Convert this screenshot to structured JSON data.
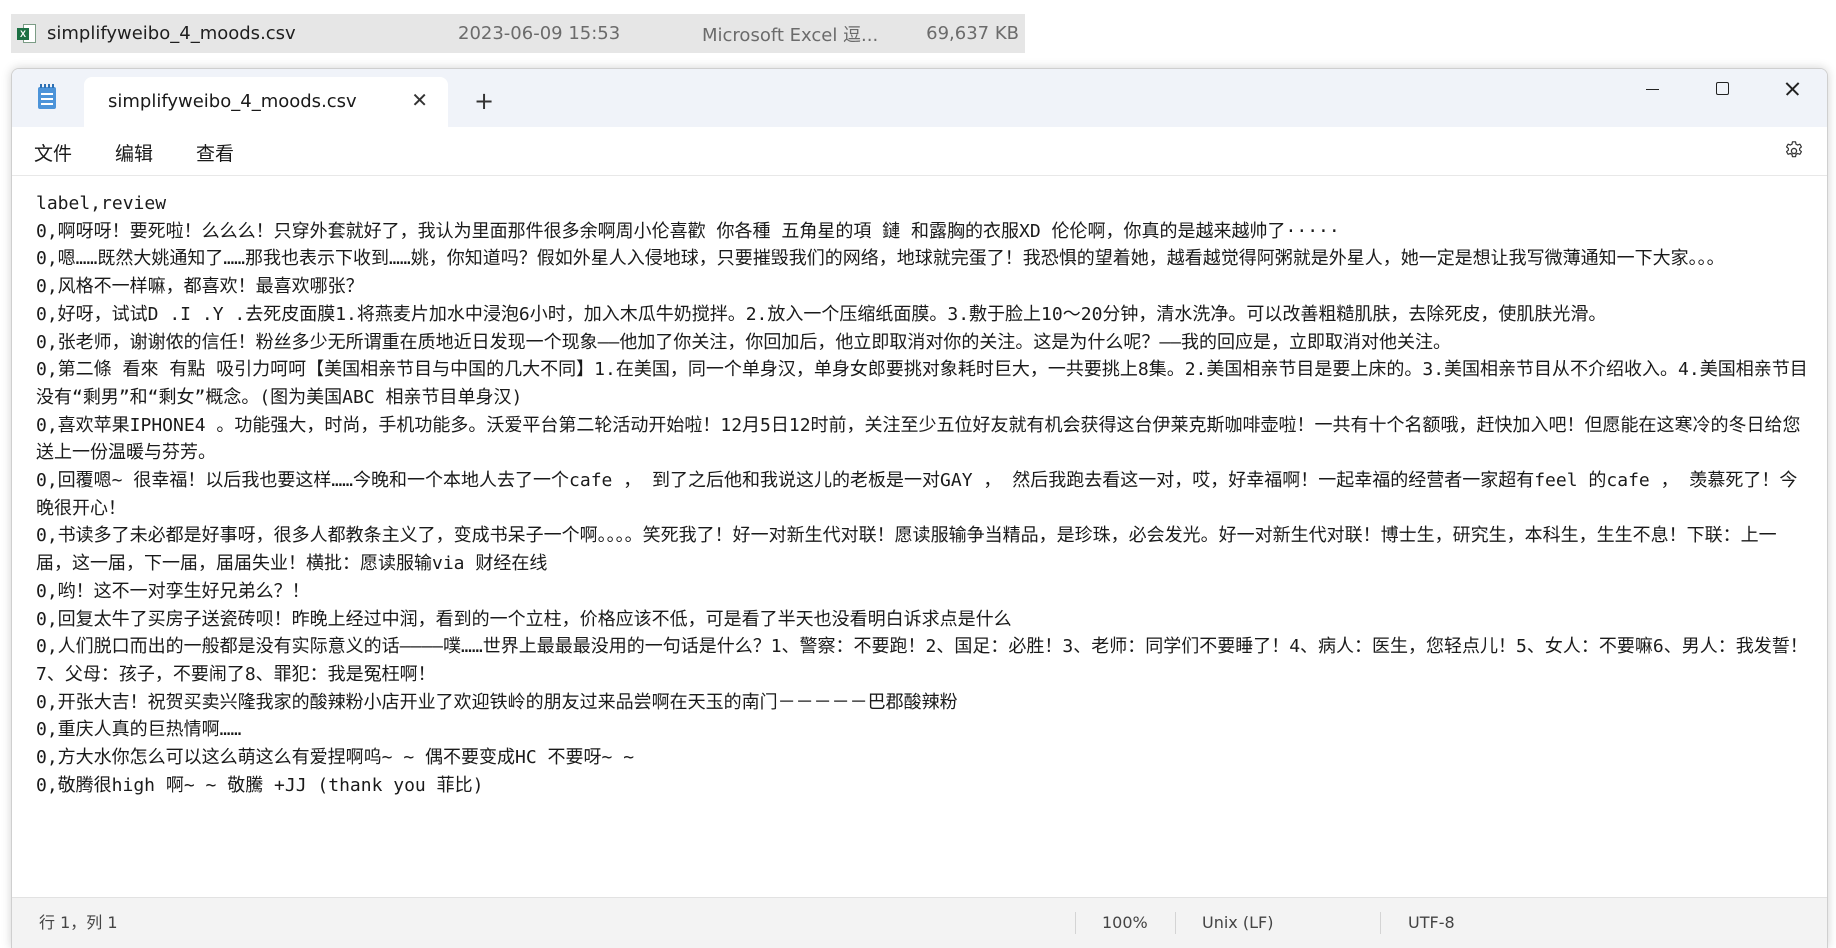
{
  "explorer_row": {
    "file_name": "simplifyweibo_4_moods.csv",
    "modified": "2023-06-09 15:53",
    "type": "Microsoft Excel 逗...",
    "size": "69,637 KB",
    "icon": "excel-file-icon"
  },
  "window": {
    "app_icon": "notepad-icon",
    "tab_title": "simplifyweibo_4_moods.csv",
    "tab_close": "✕",
    "new_tab": "+",
    "controls": [
      "minimize",
      "maximize",
      "close"
    ]
  },
  "menu": {
    "file": "文件",
    "edit": "编辑",
    "view": "查看",
    "settings_icon": "gear-icon"
  },
  "content": {
    "lines": [
      "label,review",
      "0,啊呀呀！要死啦！么么么！只穿外套就好了，我认为里面那件很多余啊周小伦喜歡 你各種 五角星的項 鏈 和露胸的衣服XD 伦伦啊，你真的是越来越帅了·····",
      "0,嗯……既然大姚通知了……那我也表示下收到……姚，你知道吗？假如外星人入侵地球，只要摧毁我们的网络，地球就完蛋了！我恐惧的望着她，越看越觉得阿粥就是外星人，她一定是想让我写微薄通知一下大家。。。",
      "0,风格不一样嘛，都喜欢！最喜欢哪张？",
      "0,好呀，试试D .I .Y .去死皮面膜1.将燕麦片加水中浸泡6小时，加入木瓜牛奶搅拌。2.放入一个压缩纸面膜。3.敷于脸上10～20分钟，清水洗净。可以改善粗糙肌肤，去除死皮，使肌肤光滑。",
      "0,张老师，谢谢侬的信任！粉丝多少无所谓重在质地近日发现一个现象——他加了你关注，你回加后，他立即取消对你的关注。这是为什么呢？——我的回应是，立即取消对他关注。",
      "0,第二條 看來 有點 吸引力呵呵【美国相亲节目与中国的几大不同】1.在美国，同一个单身汉，单身女郎要挑对象耗时巨大，一共要挑上8集。2.美国相亲节目是要上床的。3.美国相亲节目从不介绍收入。4.美国相亲节目没有“剩男”和“剩女”概念。(图为美国ABC 相亲节目单身汉)",
      "0,喜欢苹果IPHONE4 。功能强大，时尚，手机功能多。沃爱平台第二轮活动开始啦！12月5日12时前，关注至少五位好友就有机会获得这台伊莱克斯咖啡壶啦！一共有十个名额哦，赶快加入吧！但愿能在这寒冷的冬日给您送上一份温暖与芬芳。",
      "0,回覆嗯~ 很幸福！以后我也要这样……今晚和一个本地人去了一个cafe ， 到了之后他和我说这儿的老板是一对GAY ， 然后我跑去看这一对，哎，好幸福啊！一起幸福的经营者一家超有feel 的cafe ， 羡慕死了！今晚很开心！",
      "0,书读多了未必都是好事呀，很多人都教条主义了，变成书呆子一个啊。。。。笑死我了！好一对新生代对联！愿读服输争当精品，是珍珠，必会发光。好一对新生代对联！博士生，研究生，本科生，生生不息！下联：上一届，这一届，下一届，届届失业！横批：愿读服输via 财经在线",
      "0,哟！这不一对孪生好兄弟么？！",
      "0,回复太牛了买房子送瓷砖呗！昨晚上经过中润，看到的一个立柱，价格应该不低，可是看了半天也没看明白诉求点是什么",
      "0,人们脱口而出的一般都是没有实际意义的话————噗……世界上最最最没用的一句话是什么？1、警察：不要跑！2、国足：必胜！3、老师：同学们不要睡了！4、病人：医生，您轻点儿！5、女人：不要嘛6、男人：我发誓！7、父母：孩子，不要闹了8、罪犯：我是冤枉啊！",
      "0,开张大吉！祝贺买卖兴隆我家的酸辣粉小店开业了欢迎铁岭的朋友过来品尝啊在天玉的南门－－－－－巴郡酸辣粉",
      "0,重庆人真的巨热情啊……",
      "0,方大水你怎么可以这么萌这么有爱捏啊呜~ ~ 偶不要变成HC 不要呀~ ~",
      "0,敬腾很high 啊~ ~ 敬騰 +JJ (thank you 菲比)"
    ]
  },
  "status": {
    "position": "行 1，列 1",
    "zoom": "100%",
    "line_ending": "Unix (LF)",
    "encoding": "UTF-8"
  }
}
